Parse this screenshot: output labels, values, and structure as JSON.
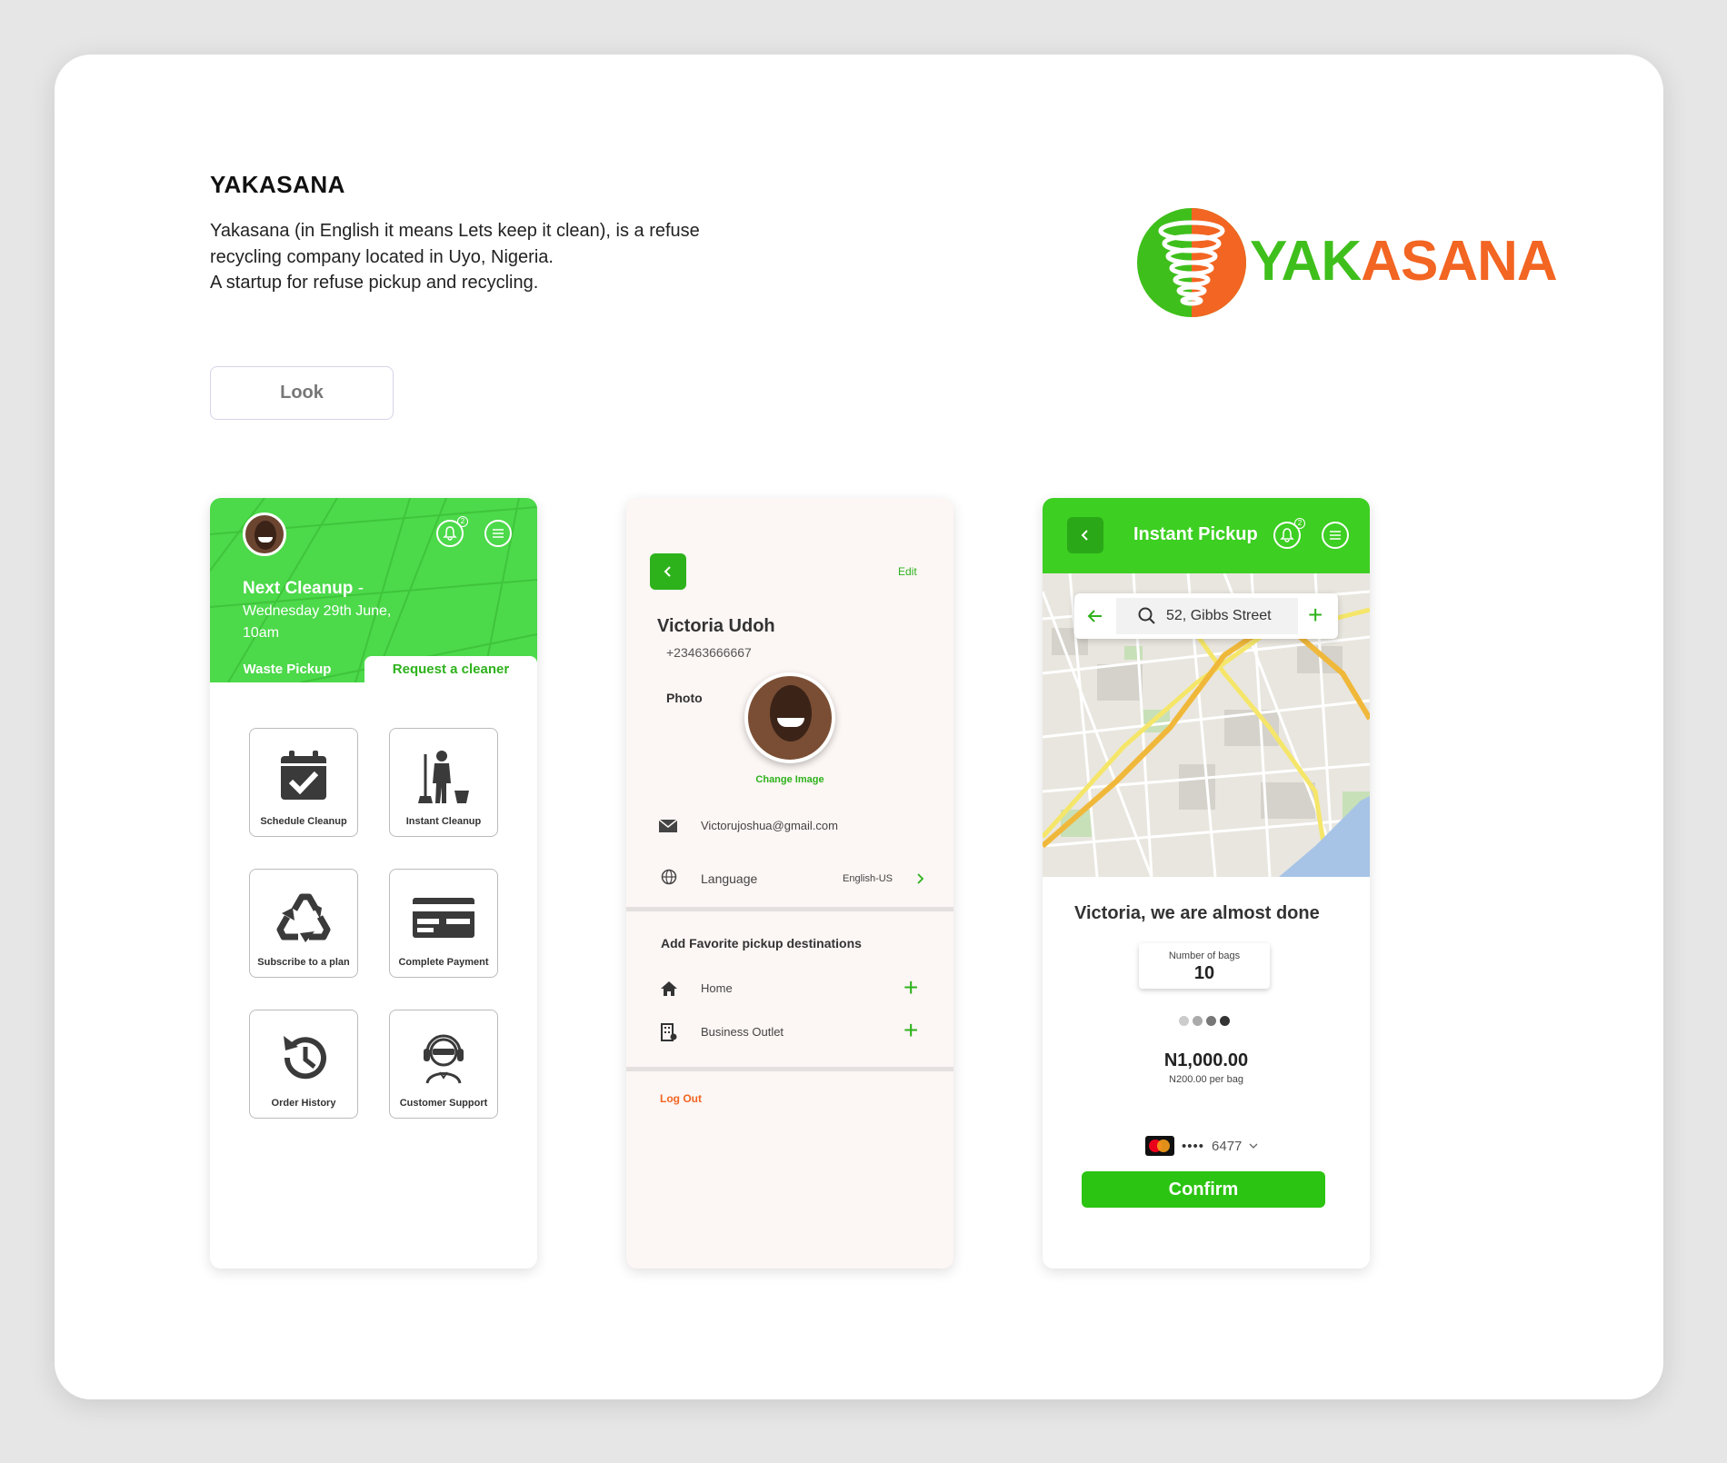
{
  "intro": {
    "title": "YAKASANA",
    "description_lines": [
      "Yakasana (in English it means Lets keep it clean), is a refuse",
      "recycling company located in Uyo, Nigeria.",
      "A startup for refuse pickup and recycling."
    ],
    "look_button": "Look"
  },
  "logo": {
    "part1": "YAK",
    "part2": "ASANA",
    "green": "#3fbf1c",
    "orange": "#f26522"
  },
  "home_screen": {
    "next_cleanup_title": "Next Cleanup",
    "next_cleanup_dash": "-",
    "next_cleanup_date": "Wednesday 29th June, 10am",
    "notification_count": "2",
    "tabs": [
      "Waste Pickup",
      "Request a cleaner"
    ],
    "tiles": [
      {
        "label": "Schedule Cleanup",
        "icon": "calendar-check-icon"
      },
      {
        "label": "Instant Cleanup",
        "icon": "cleaner-icon"
      },
      {
        "label": "Subscribe to a plan",
        "icon": "recycle-icon"
      },
      {
        "label": "Complete Payment",
        "icon": "credit-card-icon"
      },
      {
        "label": "Order History",
        "icon": "history-icon"
      },
      {
        "label": "Customer Support",
        "icon": "support-agent-icon"
      }
    ]
  },
  "profile_screen": {
    "edit": "Edit",
    "name": "Victoria Udoh",
    "phone": "+23463666667",
    "photo_label": "Photo",
    "change_image": "Change Image",
    "email": "Victorujoshua@gmail.com",
    "language_label": "Language",
    "language_value": "English-US",
    "favorites_title": "Add Favorite pickup destinations",
    "destinations": [
      "Home",
      "Business Outlet"
    ],
    "logout": "Log Out"
  },
  "pickup_screen": {
    "title": "Instant Pickup",
    "notification_count": "2",
    "search_value": "52, Gibbs Street",
    "heading": "Victoria, we are almost done",
    "bags_label": "Number of bags",
    "bags_value": "10",
    "price": "N1,000.00",
    "price_note": "N200.00 per bag",
    "card_mask": "••••",
    "card_last4": "6477",
    "confirm": "Confirm"
  }
}
